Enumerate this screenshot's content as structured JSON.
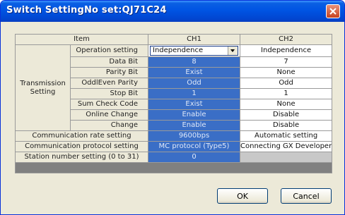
{
  "window": {
    "title": "Switch SettingNo set:QJ71C24"
  },
  "table": {
    "headers": {
      "item": "Item",
      "ch1": "CH1",
      "ch2": "CH2"
    },
    "group_label": "Transmission Setting",
    "rows": [
      {
        "label": "Operation setting",
        "ch1": "Independence",
        "ch2": "Independence"
      },
      {
        "label": "Data Bit",
        "ch1": "8",
        "ch2": "7"
      },
      {
        "label": "Parity Bit",
        "ch1": "Exist",
        "ch2": "None"
      },
      {
        "label": "OddlEven Parity",
        "ch1": "Odd",
        "ch2": "Odd"
      },
      {
        "label": "Stop Bit",
        "ch1": "1",
        "ch2": "1"
      },
      {
        "label": "Sum Check Code",
        "ch1": "Exist",
        "ch2": "None"
      },
      {
        "label": "Online Change",
        "ch1": "Enable",
        "ch2": "Disable"
      },
      {
        "label": "Change",
        "ch1": "Enable",
        "ch2": "Disable"
      }
    ],
    "comm_rate": {
      "label": "Communication rate setting",
      "ch1": "9600bps",
      "ch2": "Automatic setting"
    },
    "comm_protocol": {
      "label": "Communication protocol setting",
      "ch1": "MC protocol (Type5)",
      "ch2": "Connecting GX Developer"
    },
    "station": {
      "label": "Station number setting (0 to 31)",
      "ch1": "0"
    }
  },
  "buttons": {
    "ok": "OK",
    "cancel": "Cancel"
  },
  "icons": {
    "close": "close-icon",
    "dropdown": "chevron-down-icon"
  },
  "colors": {
    "titlebar": "#0054e3",
    "selected_cell": "#3a6ec6",
    "dialog_bg": "#ece9d8"
  }
}
